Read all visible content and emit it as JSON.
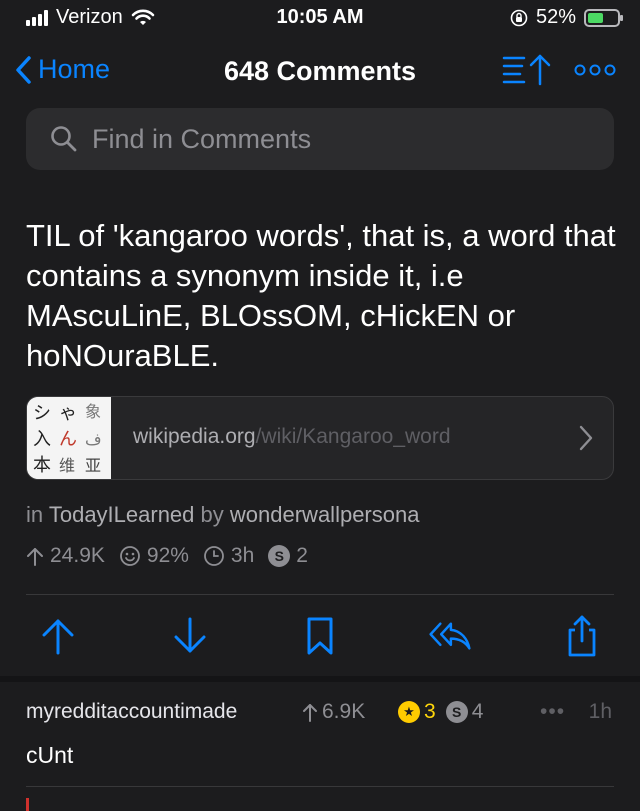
{
  "status": {
    "carrier": "Verizon",
    "time": "10:05 AM",
    "battery": "52%",
    "battery_level": 0.52
  },
  "nav": {
    "back_label": "Home",
    "title": "648 Comments"
  },
  "search": {
    "placeholder": "Find in Comments"
  },
  "post": {
    "title": "TIL of 'kangaroo words', that is, a word that contains a synonym inside it, i.e MAscuLinE, BLOssOM, cHickEN or hoNOuraBLE.",
    "link_domain": "wikipedia.org",
    "link_path": "/wiki/Kangaroo_word",
    "subreddit_prefix": "in",
    "subreddit": "TodayILearned",
    "author_prefix": "by",
    "author": "wonderwallpersona",
    "upvotes": "24.9K",
    "upvote_ratio": "92%",
    "age": "3h",
    "silver_awards": "2"
  },
  "comment": {
    "user": "myredditaccountimade",
    "score": "6.9K",
    "gold_awards": "3",
    "silver_awards": "4",
    "more": "•••",
    "age": "1h",
    "body": "cUnt"
  },
  "colors": {
    "accent": "#0a84ff",
    "background": "#1c1c1e",
    "gold": "#ffcc00"
  }
}
